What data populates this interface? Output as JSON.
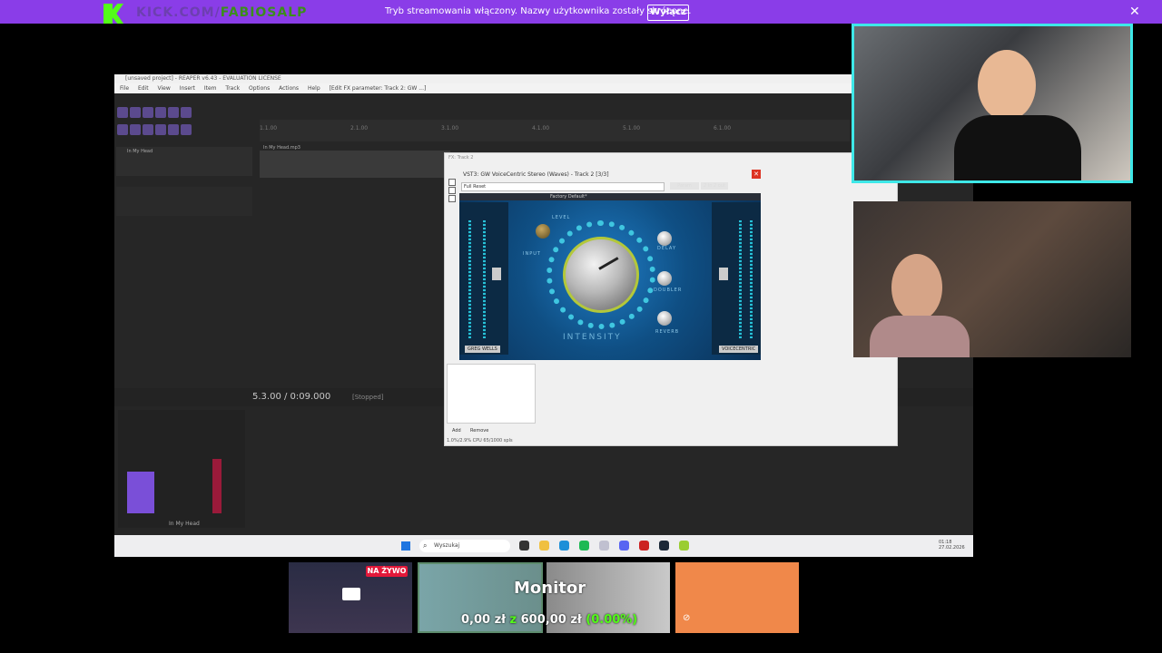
{
  "banner": {
    "channel_prefix": "KICK.COM/",
    "channel_name": "FABIOSALP",
    "message": "Tryb streamowania włączony. Nazwy użytkownika zostały skrócone.",
    "button_label": "Wyłącz",
    "close_glyph": "✕",
    "accent_color": "#8a3de8"
  },
  "reaper": {
    "title": "[unsaved project] - REAPER v6.43 - EVALUATION LICENSE",
    "menu": [
      "File",
      "Edit",
      "View",
      "Insert",
      "Item",
      "Track",
      "Options",
      "Actions",
      "Help",
      "[Edit FX parameter: Track 2: GW ...]"
    ],
    "track1_name": "In My Head",
    "item_name": "In My Head.mp3",
    "time": "5.3.00 / 0:09.000",
    "status": "[Stopped]",
    "mixer_track_name": "In My Head",
    "ruler_ticks": [
      "1.1.00",
      "2.1.00",
      "3.1.00",
      "4.1.00",
      "5.1.00",
      "6.1.00"
    ]
  },
  "fx_window": {
    "title": "FX: Track 2",
    "plugin_title": "VST3: GW VoiceCentric Stereo (Waves) - Track 2 [3/3]",
    "preset": "Full Reset",
    "param_button": "Param",
    "io_button": "2 in 2 out",
    "close_glyph": "✕",
    "plugin": {
      "toolbar": "Factory Default*",
      "label_level": "LEVEL",
      "label_input": "INPUT",
      "label_delay": "DELAY",
      "label_doubler": "DOUBLER",
      "label_reverb": "REVERB",
      "label_intensity": "INTENSITY",
      "brand": "GREG WELLS",
      "product": "VOICECENTRIC"
    },
    "add_button": "Add",
    "remove_button": "Remove",
    "cpu": "1.0%/2.9% CPU 65/1000 spls"
  },
  "taskbar": {
    "search_placeholder": "Wyszukaj",
    "time": "01:18",
    "date": "27.02.2026"
  },
  "tiles": {
    "live_badge": "NA ŻYWO",
    "monitor_title": "Monitor",
    "goal_current": "0,00 zł",
    "goal_sep": "z",
    "goal_target": "600,00 zł",
    "goal_percent": "(0.00%)"
  }
}
